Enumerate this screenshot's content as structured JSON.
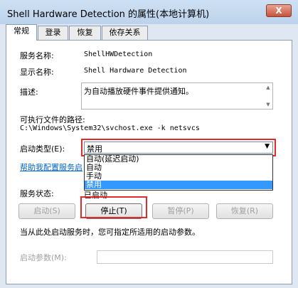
{
  "window": {
    "title": "Shell Hardware Detection 的属性(本地计算机)",
    "close_glyph": "X"
  },
  "tabs": [
    {
      "label": "常规"
    },
    {
      "label": "登录"
    },
    {
      "label": "恢复"
    },
    {
      "label": "依存关系"
    }
  ],
  "general": {
    "service_name_label": "服务名称:",
    "service_name_value": "ShellHWDetection",
    "display_name_label": "显示名称:",
    "display_name_value": "Shell Hardware Detection",
    "description_label": "描述:",
    "description_value": "为自动播放硬件事件提供通知。",
    "path_label": "可执行文件的路径:",
    "path_value": "C:\\Windows\\System32\\svchost.exe -k netsvcs",
    "startup_type_label": "启动类型(E):",
    "startup_type_value": "禁用",
    "startup_options": [
      "自动(延迟启动)",
      "自动",
      "手动",
      "禁用"
    ],
    "help_link": "帮助我配置服务启",
    "status_label": "服务状态:",
    "status_value": "已启动",
    "buttons": {
      "start": "启动(S)",
      "stop": "停止(T)",
      "pause": "暂停(P)",
      "resume": "恢复(R)"
    },
    "note": "当从此处启动服务时，您可指定所适用的启动参数。",
    "start_params_label": "启动参数(M):",
    "start_params_value": ""
  },
  "colors": {
    "highlight_border": "#e22b2b",
    "selected_option": "#3399ff",
    "link": "#0066cc"
  }
}
